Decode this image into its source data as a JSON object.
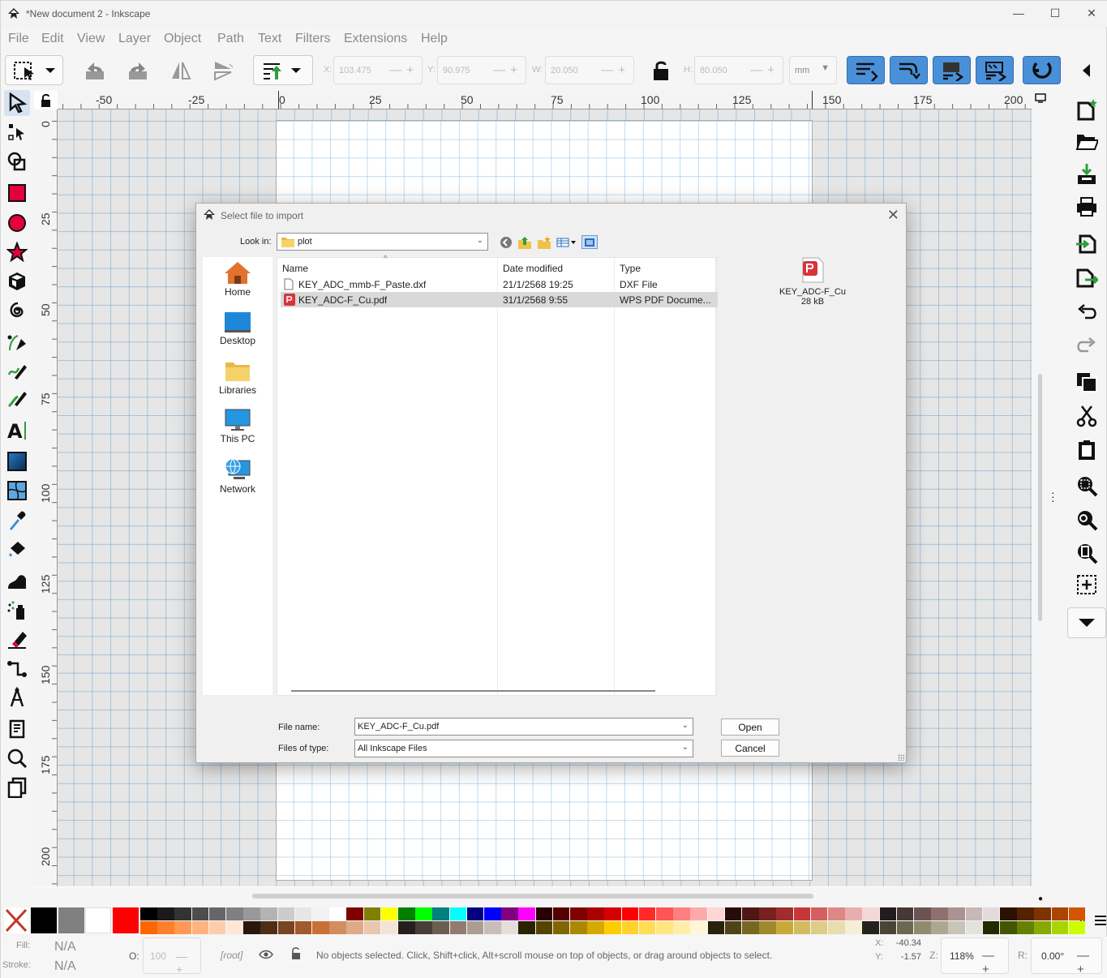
{
  "window": {
    "title": "*New document 2 - Inkscape",
    "minimize": "—",
    "maximize": "☐",
    "close": "✕"
  },
  "menu": [
    "File",
    "Edit",
    "View",
    "Layer",
    "Object",
    "Path",
    "Text",
    "Filters",
    "Extensions",
    "Help"
  ],
  "toolbar": {
    "x_label": "X:",
    "x_value": "103.475",
    "y_label": "Y:",
    "y_value": "90.975",
    "w_label": "W:",
    "w_value": "20.050",
    "h_label": "H:",
    "h_value": "80.050",
    "unit": "mm"
  },
  "ruler": {
    "h_ticks": [
      "-50",
      "-25",
      "0",
      "25",
      "50",
      "75",
      "100",
      "125",
      "150",
      "175",
      "200"
    ],
    "v_ticks": [
      "0",
      "25",
      "50",
      "75",
      "100",
      "125",
      "150",
      "175",
      "200"
    ]
  },
  "dialog": {
    "title": "Select file to import",
    "look_in_label": "Look in:",
    "look_in_value": "plot",
    "places": [
      "Home",
      "Desktop",
      "Libraries",
      "This PC",
      "Network"
    ],
    "columns": [
      "Name",
      "Date modified",
      "Type"
    ],
    "files": [
      {
        "name": "KEY_ADC_mmb-F_Paste.dxf",
        "date": "21/1/2568 19:25",
        "type": "DXF File"
      },
      {
        "name": "KEY_ADC-F_Cu.pdf",
        "date": "31/1/2568 9:55",
        "type": "WPS PDF Docume..."
      }
    ],
    "preview_name": "KEY_ADC-F_Cu",
    "preview_size": "28 kB",
    "file_name_label": "File name:",
    "file_name_value": "KEY_ADC-F_Cu.pdf",
    "files_of_type_label": "Files of type:",
    "files_of_type_value": "All Inkscape Files",
    "open_label": "Open",
    "cancel_label": "Cancel"
  },
  "status": {
    "fill_label": "Fill:",
    "fill_value": "N/A",
    "stroke_label": "Stroke:",
    "stroke_value": "N/A",
    "opacity_label": "O:",
    "opacity_value": "100",
    "layer": "[root]",
    "message": "No objects selected. Click, Shift+click, Alt+scroll mouse on top of objects, or drag around objects to select.",
    "x_label": "X:",
    "x_coord": "-40.34",
    "y_label": "Y:",
    "y_coord": "-1.57",
    "zoom_label": "Z:",
    "zoom": "118%",
    "rotate_label": "R:",
    "rotation": "0.00°"
  },
  "palette": {
    "row1": [
      "#000000",
      "#1a1a1a",
      "#333333",
      "#4d4d4d",
      "#666666",
      "#808080",
      "#999999",
      "#b3b3b3",
      "#cccccc",
      "#e6e6e6",
      "#f2f2f2",
      "#ffffff",
      "#800000",
      "#808000",
      "#ffff00",
      "#008000",
      "#00ff00",
      "#008080",
      "#00ffff",
      "#000080",
      "#0000ff",
      "#800080",
      "#ff00ff",
      "#2b0000",
      "#550000",
      "#800000",
      "#aa0000",
      "#d40000",
      "#ff0000",
      "#ff2a2a",
      "#ff5555",
      "#ff8080",
      "#ffaaaa",
      "#ffd5d5",
      "#280b0b",
      "#501616",
      "#782121",
      "#a02c2c",
      "#c83737",
      "#d35f5f",
      "#de8787",
      "#e9afaf",
      "#f4d7d7",
      "#241c1c",
      "#483737",
      "#6c5353",
      "#916f6f",
      "#ac9393",
      "#c8b7b7",
      "#e3dbdb",
      "#2b1100",
      "#552200",
      "#803300",
      "#aa4400",
      "#d45500"
    ],
    "row2": [
      "#ff6600",
      "#ff7f2a",
      "#ff9955",
      "#ffb380",
      "#ffccaa",
      "#ffe6d5",
      "#28170b",
      "#502d16",
      "#784421",
      "#a05a2c",
      "#c87137",
      "#d38d5f",
      "#deaa87",
      "#e9c6af",
      "#f4e3d7",
      "#241f1c",
      "#483e37",
      "#6c5d53",
      "#917c6f",
      "#ac9d93",
      "#c8beb7",
      "#e3dedb",
      "#2b2200",
      "#554400",
      "#806600",
      "#aa8800",
      "#d4aa00",
      "#ffcc00",
      "#ffd42a",
      "#ffdd55",
      "#ffe680",
      "#ffeeaa",
      "#fff6d5",
      "#28220b",
      "#504416",
      "#786721",
      "#a0892c",
      "#c8ab37",
      "#d3bc5f",
      "#decd87",
      "#e9ddaf",
      "#f4eed7",
      "#24221c",
      "#484537",
      "#6c6753",
      "#918a6f",
      "#aca793",
      "#c8c4b7",
      "#e3e2db",
      "#222b00",
      "#445500",
      "#668000",
      "#88aa00",
      "#aad400",
      "#ccff00"
    ]
  }
}
